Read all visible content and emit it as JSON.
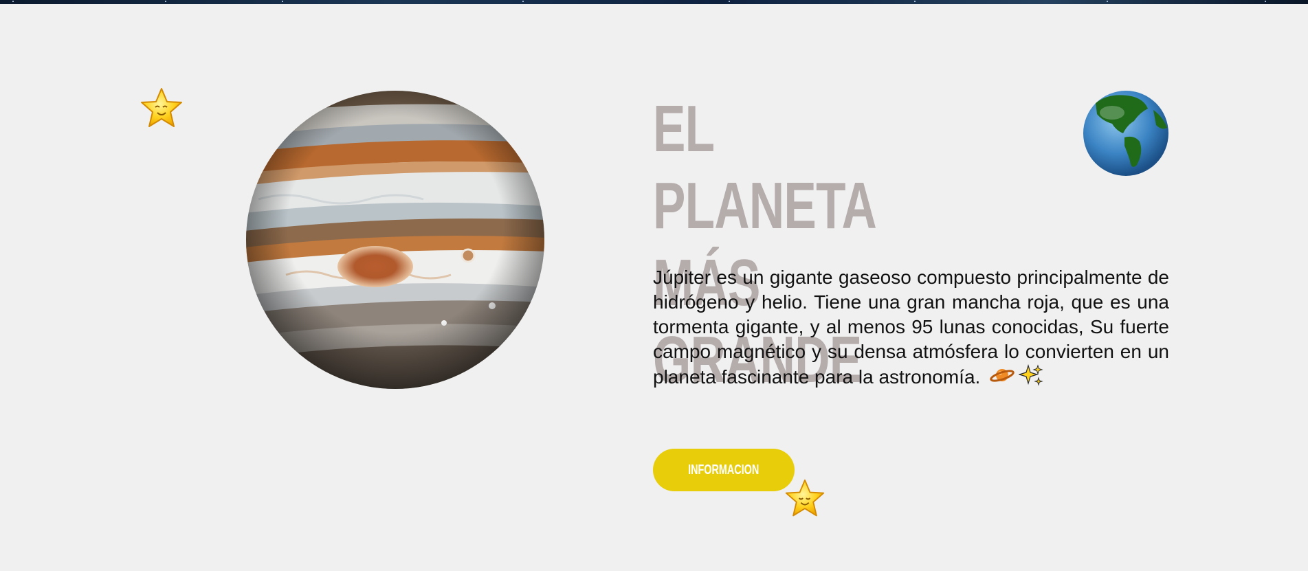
{
  "hero": {
    "title": "EL PLANETA MÁS GRANDE",
    "description": "Júpiter es un gigante gaseoso compuesto principalmente de hidrógeno y helio. Tiene una gran mancha roja, que es una tormenta gigante, y al menos 95 lunas conocidas, Su fuerte campo magnético y su densa atmósfera lo convierten en un planeta fascinante para la astronomía.",
    "emojis": [
      "ringed-planet-icon",
      "sparkles-icon"
    ],
    "button_label": "INFORMACION"
  },
  "images": {
    "main_planet": "jupiter",
    "corner_planet": "earth"
  },
  "colors": {
    "background": "#f0f0f0",
    "title": "#b5acac",
    "text": "#111111",
    "button": "#e8cd0a",
    "button_text": "#ffffff",
    "star": "#ffd21f"
  }
}
